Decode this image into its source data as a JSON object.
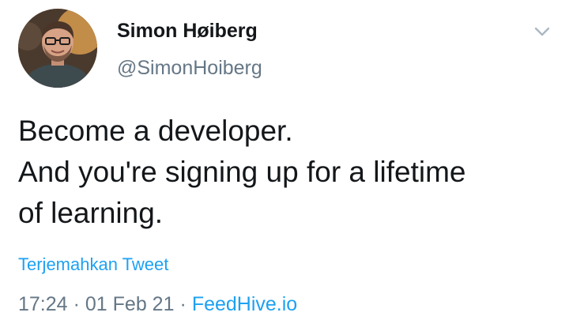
{
  "user": {
    "display_name": "Simon Høiberg",
    "handle": "@SimonHoiberg"
  },
  "tweet": {
    "lines": [
      "Become a developer.",
      "And you're signing up for a lifetime",
      "of learning."
    ],
    "translate_label": "Terjemahkan Tweet",
    "time": "17:24",
    "separator": "·",
    "date": "01 Feb 21",
    "source": "FeedHive.io"
  },
  "icons": {
    "more": "chevron-down-icon",
    "avatar": "user-avatar"
  },
  "colors": {
    "text_primary": "#14171a",
    "text_secondary": "#657786",
    "link": "#1da1f2",
    "background": "#ffffff"
  }
}
